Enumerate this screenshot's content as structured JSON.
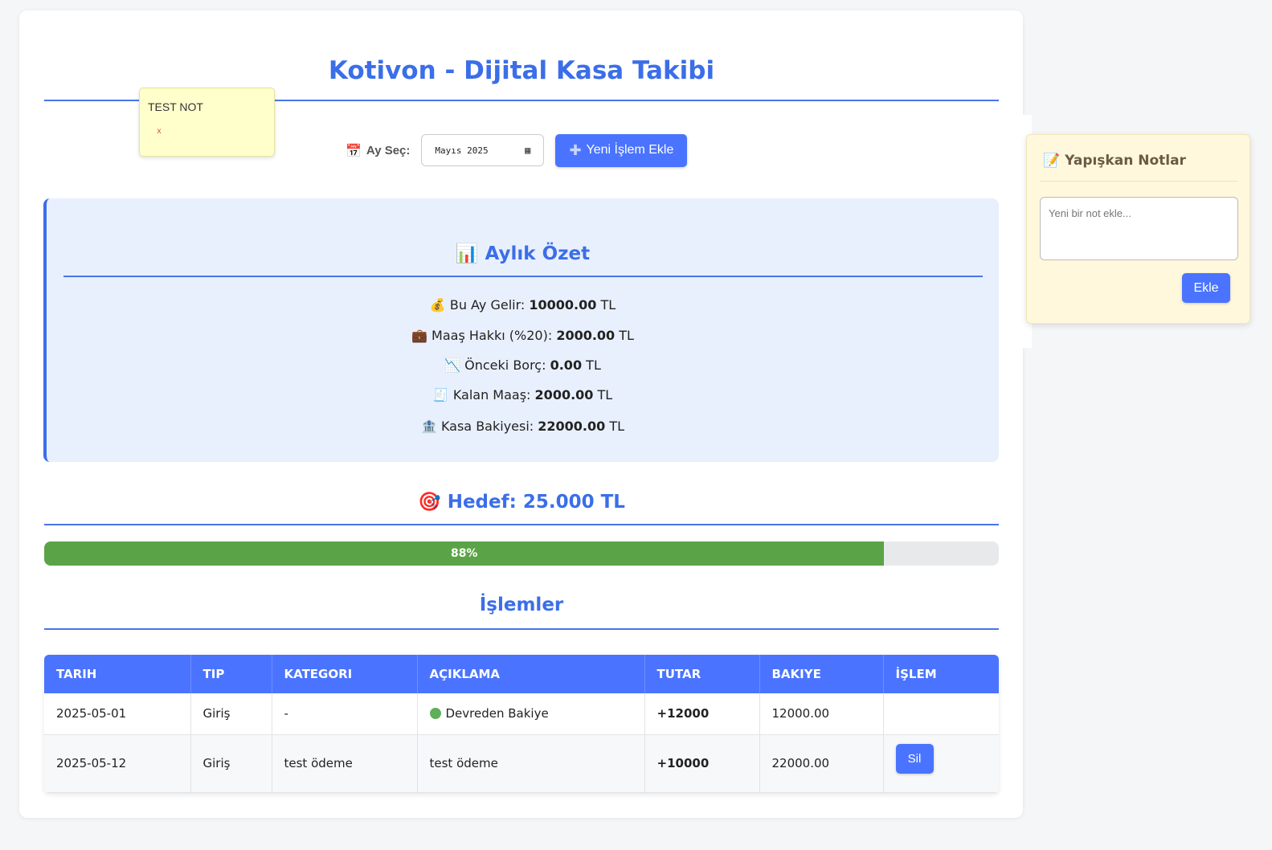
{
  "header": {
    "title": "Kotivon - Dijital Kasa Takibi"
  },
  "note": {
    "text": "TEST NOT",
    "close": "x"
  },
  "controls": {
    "month_label": "Ay Seç:",
    "month_value": "Mayıs 2025",
    "add_button": "Yeni İşlem Ekle"
  },
  "summary": {
    "title": "Aylık Özet",
    "rows": [
      {
        "icon": "💰",
        "label": "Bu Ay Gelir:",
        "value": "10000.00",
        "unit": "TL"
      },
      {
        "icon": "💼",
        "label": "Maaş Hakkı (%20):",
        "value": "2000.00",
        "unit": "TL"
      },
      {
        "icon": "📉",
        "label": "Önceki Borç:",
        "value": "0.00",
        "unit": "TL"
      },
      {
        "icon": "🧾",
        "label": "Kalan Maaş:",
        "value": "2000.00",
        "unit": "TL"
      },
      {
        "icon": "🏦",
        "label": "Kasa Bakiyesi:",
        "value": "22000.00",
        "unit": "TL"
      }
    ]
  },
  "goal": {
    "title": "Hedef: 25.000 TL",
    "progress_label": "88%",
    "progress_value": 0.88
  },
  "transactions": {
    "title": "İşlemler",
    "columns": [
      "Tarih",
      "Tip",
      "Kategori",
      "Açıklama",
      "Tutar",
      "Bakiye",
      "İşlem"
    ],
    "rows": [
      {
        "date": "2025-05-01",
        "type": "Giriş",
        "category": "-",
        "description": "Devreden Bakiye",
        "amount": "+12000",
        "balance": "12000.00",
        "action": ""
      },
      {
        "date": "2025-05-12",
        "type": "Giriş",
        "category": "test ödeme",
        "description": "test ödeme",
        "amount": "+10000",
        "balance": "22000.00",
        "action": "Sil"
      }
    ]
  },
  "sticky_notes": {
    "title": "Yapışkan Notlar",
    "placeholder": "Yeni bir not ekle...",
    "button": "Ekle"
  },
  "colors": {
    "accent": "#3b6ee8",
    "button": "#4a74ff",
    "progress": "#5aa447",
    "positive": "#2e8b2e"
  }
}
